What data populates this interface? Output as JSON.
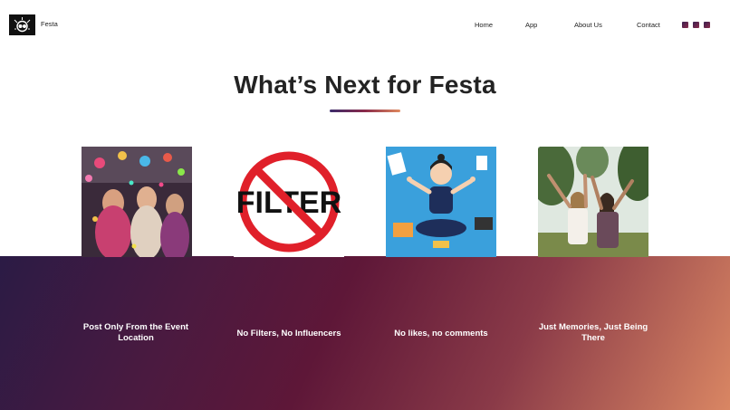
{
  "header": {
    "brand_name": "Festa",
    "logo_icon": "festa-logo-icon",
    "nav": [
      {
        "label": "Home"
      },
      {
        "label": "App"
      },
      {
        "label": "About Us"
      },
      {
        "label": "Contact"
      }
    ],
    "social_icons": [
      "social-icon-1",
      "social-icon-2",
      "social-icon-3"
    ]
  },
  "main": {
    "headline": "What’s Next for Festa"
  },
  "features": [
    {
      "title": "Post Only From the Event Location",
      "image": "party-crowd-image"
    },
    {
      "title": "No Filters, No Influencers",
      "image": "no-filter-sign-image"
    },
    {
      "title": "No likes, no comments",
      "image": "meditating-woman-illustration"
    },
    {
      "title": "Just Memories, Just Being There",
      "image": "friends-outdoors-image"
    }
  ],
  "colors": {
    "band_gradient_start": "#2b1b45",
    "band_gradient_mid": "#5e1738",
    "band_gradient_end": "#d98663",
    "divider_start": "#3b2b6b",
    "divider_end": "#e08a5f"
  }
}
